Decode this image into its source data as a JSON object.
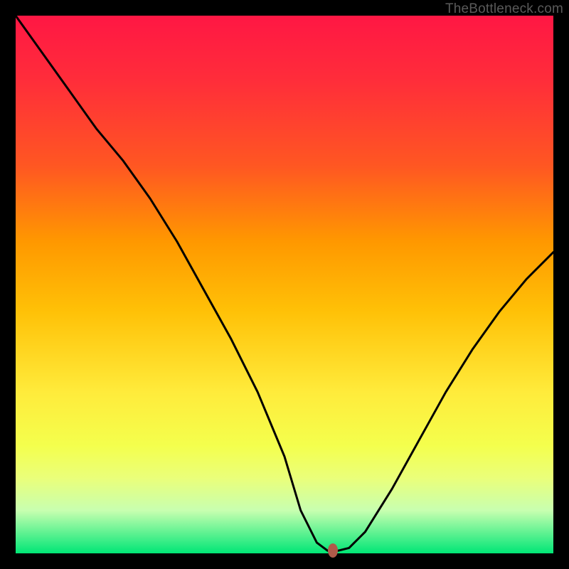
{
  "watermark": "TheBottleneck.com",
  "chart_data": {
    "type": "line",
    "title": "",
    "xlabel": "",
    "ylabel": "",
    "xlim": [
      0,
      100
    ],
    "ylim": [
      0,
      100
    ],
    "series": [
      {
        "name": "curve",
        "x": [
          0,
          5,
          10,
          15,
          20,
          25,
          30,
          35,
          40,
          45,
          50,
          53,
          56,
          58,
          60,
          62,
          65,
          70,
          75,
          80,
          85,
          90,
          95,
          100
        ],
        "y": [
          100,
          93,
          86,
          79,
          73,
          66,
          58,
          49,
          40,
          30,
          18,
          8,
          2,
          0.5,
          0.5,
          1,
          4,
          12,
          21,
          30,
          38,
          45,
          51,
          56
        ]
      }
    ],
    "marker": {
      "x": 59,
      "y": 0.5
    },
    "background": "rainbow-vertical-gradient",
    "grid": false,
    "legend": false
  }
}
